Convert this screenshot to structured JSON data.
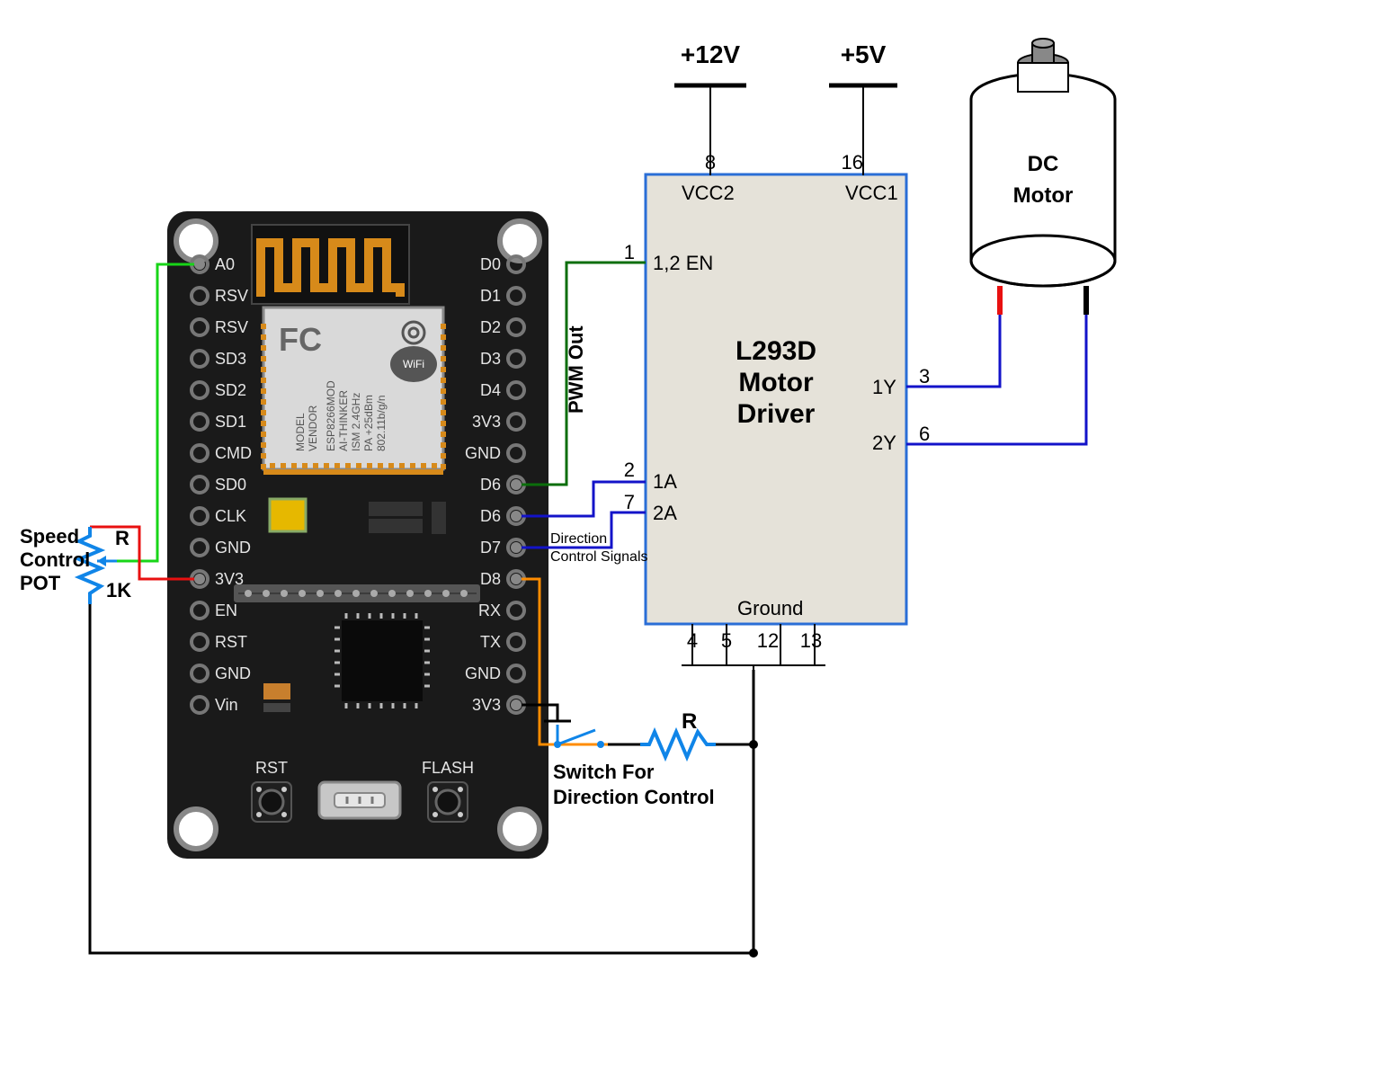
{
  "voltages": {
    "v12": "+12V",
    "v5": "+5V"
  },
  "driver": {
    "title1": "L293D",
    "title2": "Motor",
    "title3": "Driver",
    "pins": {
      "p1": "1",
      "p2": "2",
      "p3": "3",
      "p4": "4",
      "p5": "5",
      "p6": "6",
      "p7": "7",
      "p8": "8",
      "p12": "12",
      "p13": "13",
      "p16": "16"
    },
    "labels": {
      "vcc2": "VCC2",
      "vcc1": "VCC1",
      "en": "1,2 EN",
      "a1": "1A",
      "a2": "2A",
      "y1": "1Y",
      "y2": "2Y",
      "gnd": "Ground"
    }
  },
  "motor": {
    "line1": "DC",
    "line2": "Motor"
  },
  "pot": {
    "line1": "Speed",
    "line2": "Control",
    "line3": "POT",
    "r": "R",
    "val": "1K"
  },
  "switch": {
    "line1": "Switch For",
    "line2": "Direction Control",
    "r": "R"
  },
  "signals": {
    "pwm": "PWM Out",
    "dir1": "Direction",
    "dir2": "Control Signals"
  },
  "mcu": {
    "chipVendor": "VENDOR",
    "chipModel": "MODEL",
    "chipPart": "ESP8266MOD",
    "chipAi": "AI-THINKER",
    "chipIsm": "ISM 2.4GHz",
    "chipPa": "PA +25dBm",
    "chip802": "802.11b/g/n",
    "wifi": "WiFi",
    "fc": "FC",
    "pinsLeft": [
      "A0",
      "RSV",
      "RSV",
      "SD3",
      "SD2",
      "SD1",
      "CMD",
      "SD0",
      "CLK",
      "GND",
      "3V3",
      "EN",
      "RST",
      "GND",
      "Vin"
    ],
    "pinsRight": [
      "D0",
      "D1",
      "D2",
      "D3",
      "D4",
      "3V3",
      "GND",
      "D6",
      "D6",
      "D7",
      "D8",
      "RX",
      "TX",
      "GND",
      "3V3"
    ],
    "btnRst": "RST",
    "btnFlash": "FLASH"
  }
}
